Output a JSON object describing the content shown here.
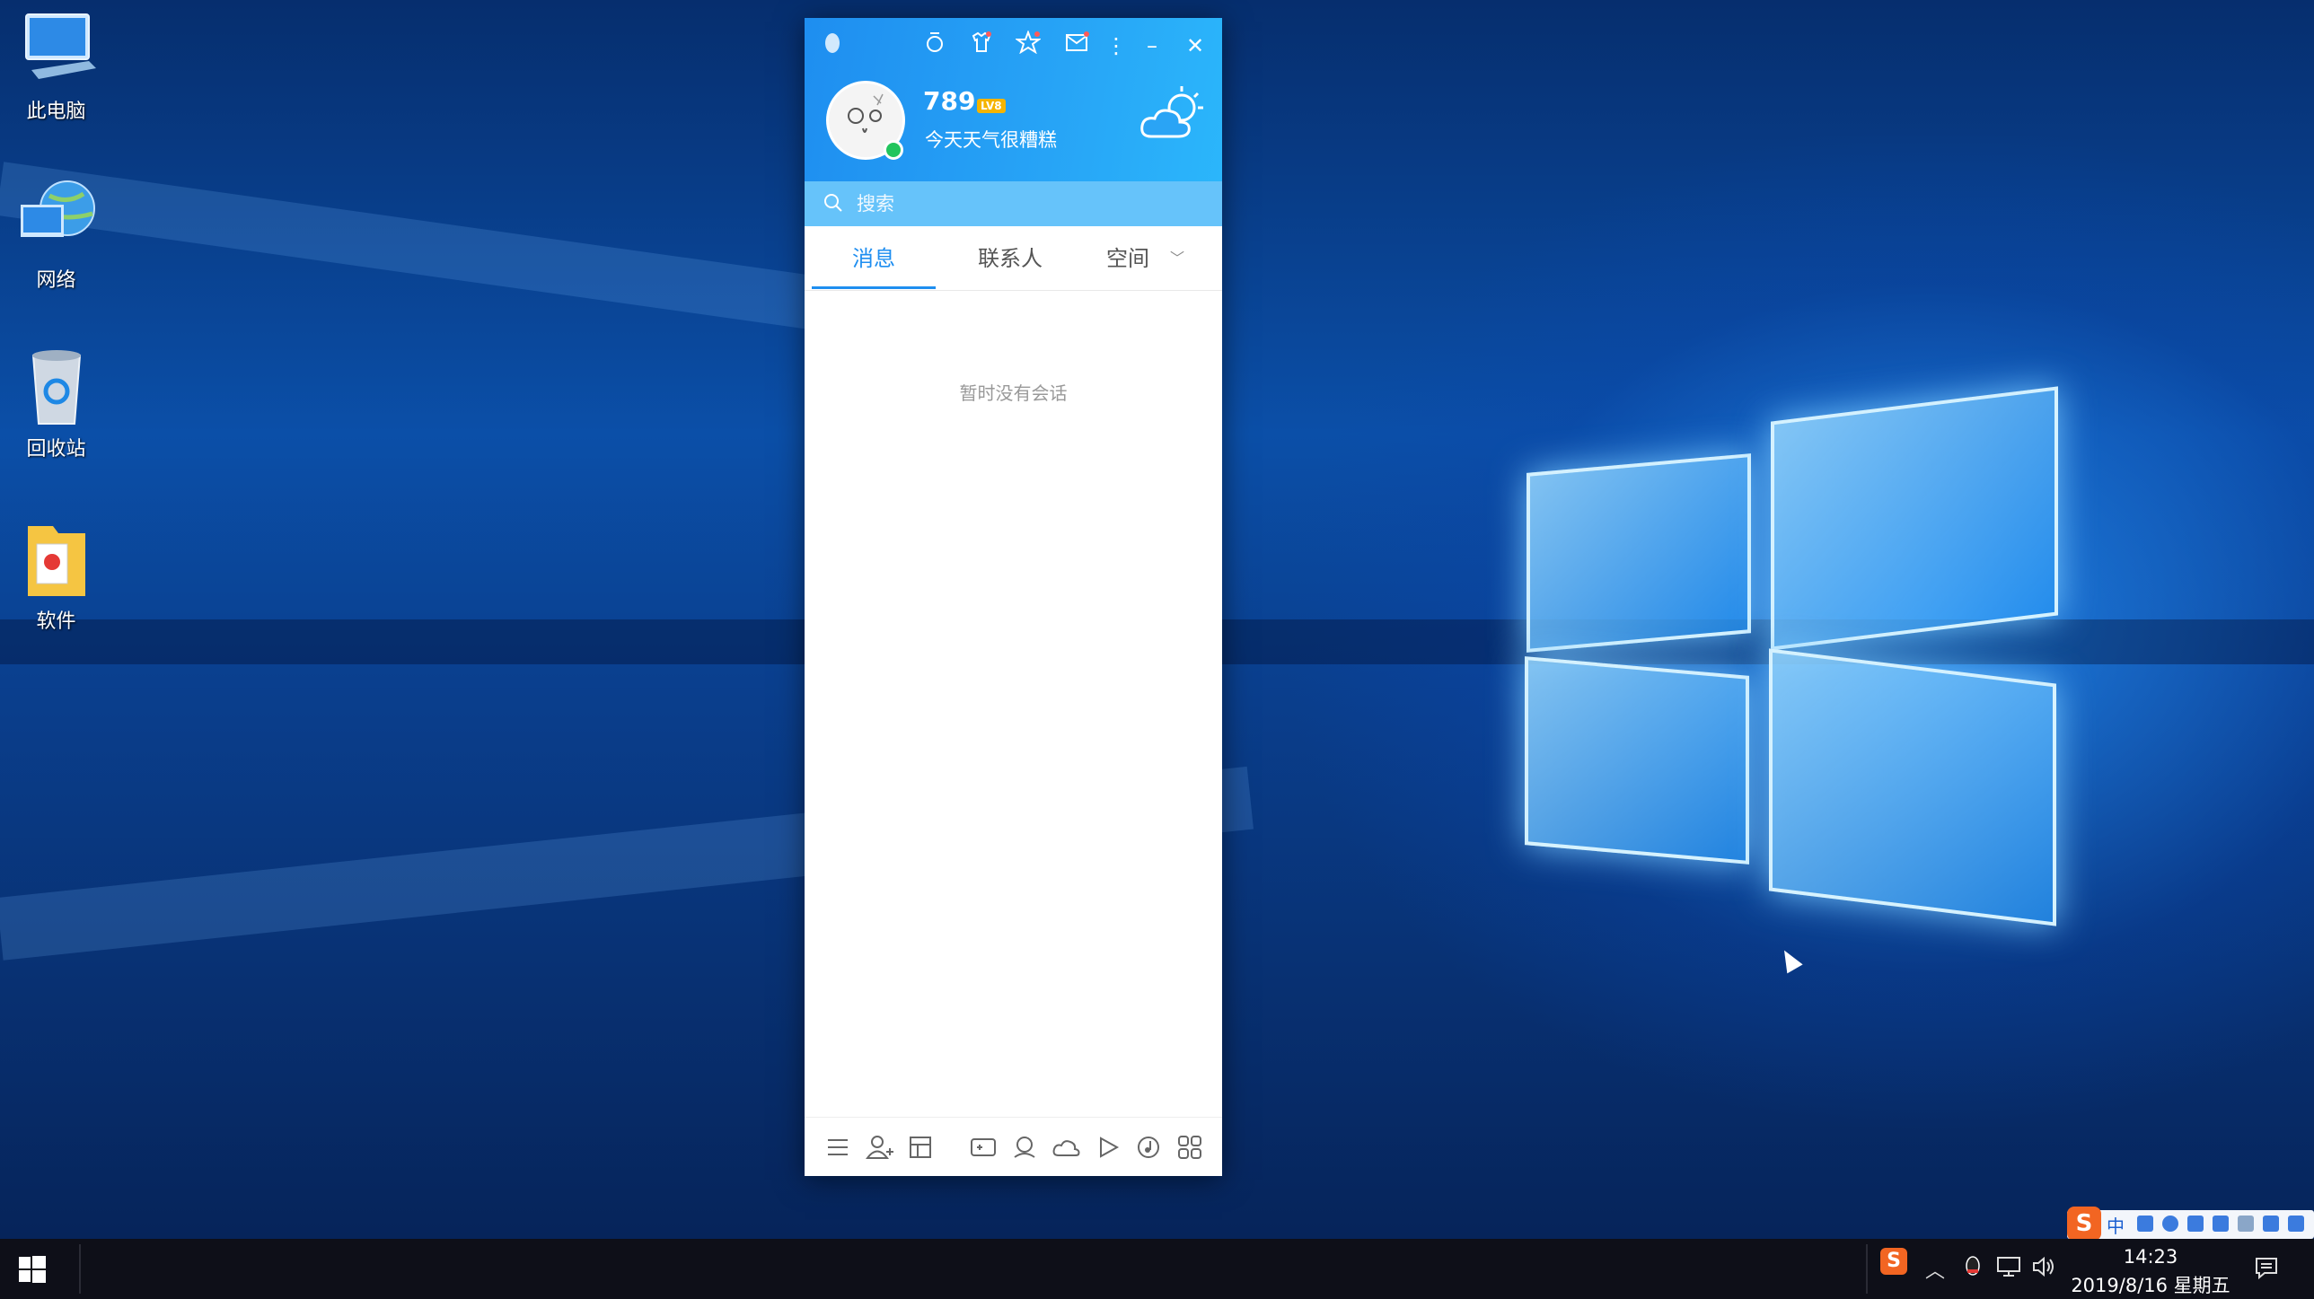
{
  "desktop": {
    "icons": [
      {
        "label": "此电脑",
        "icon": "computer-icon"
      },
      {
        "label": "网络",
        "icon": "network-icon"
      },
      {
        "label": "回收站",
        "icon": "recycle-bin-icon"
      },
      {
        "label": "软件",
        "icon": "folder-icon"
      }
    ]
  },
  "qq": {
    "titlebar_icons": [
      "penguin-icon",
      "medal-icon",
      "shirt-icon",
      "star-icon",
      "mail-icon",
      "more-icon",
      "minimize-icon",
      "close-icon"
    ],
    "nickname": "789",
    "level_badge": "LV8",
    "signature": "今天天气很糟糕",
    "weather_icon": "cloud-sun-icon",
    "search": {
      "placeholder": "搜索"
    },
    "tabs": [
      {
        "label": "消息",
        "active": true
      },
      {
        "label": "联系人",
        "active": false
      },
      {
        "label": "空间",
        "active": false
      }
    ],
    "empty_message": "暂时没有会话",
    "bottom_icons": [
      "menu-icon",
      "add-friend-icon",
      "groups-icon",
      "game-icon",
      "weiyun-icon",
      "cloud-icon",
      "video-icon",
      "music-icon",
      "apps-icon"
    ],
    "accent_color": "#1e8ef0"
  },
  "taskbar": {
    "ime_mode": "中",
    "time": "14:23",
    "date": "2019/8/16 星期五"
  }
}
